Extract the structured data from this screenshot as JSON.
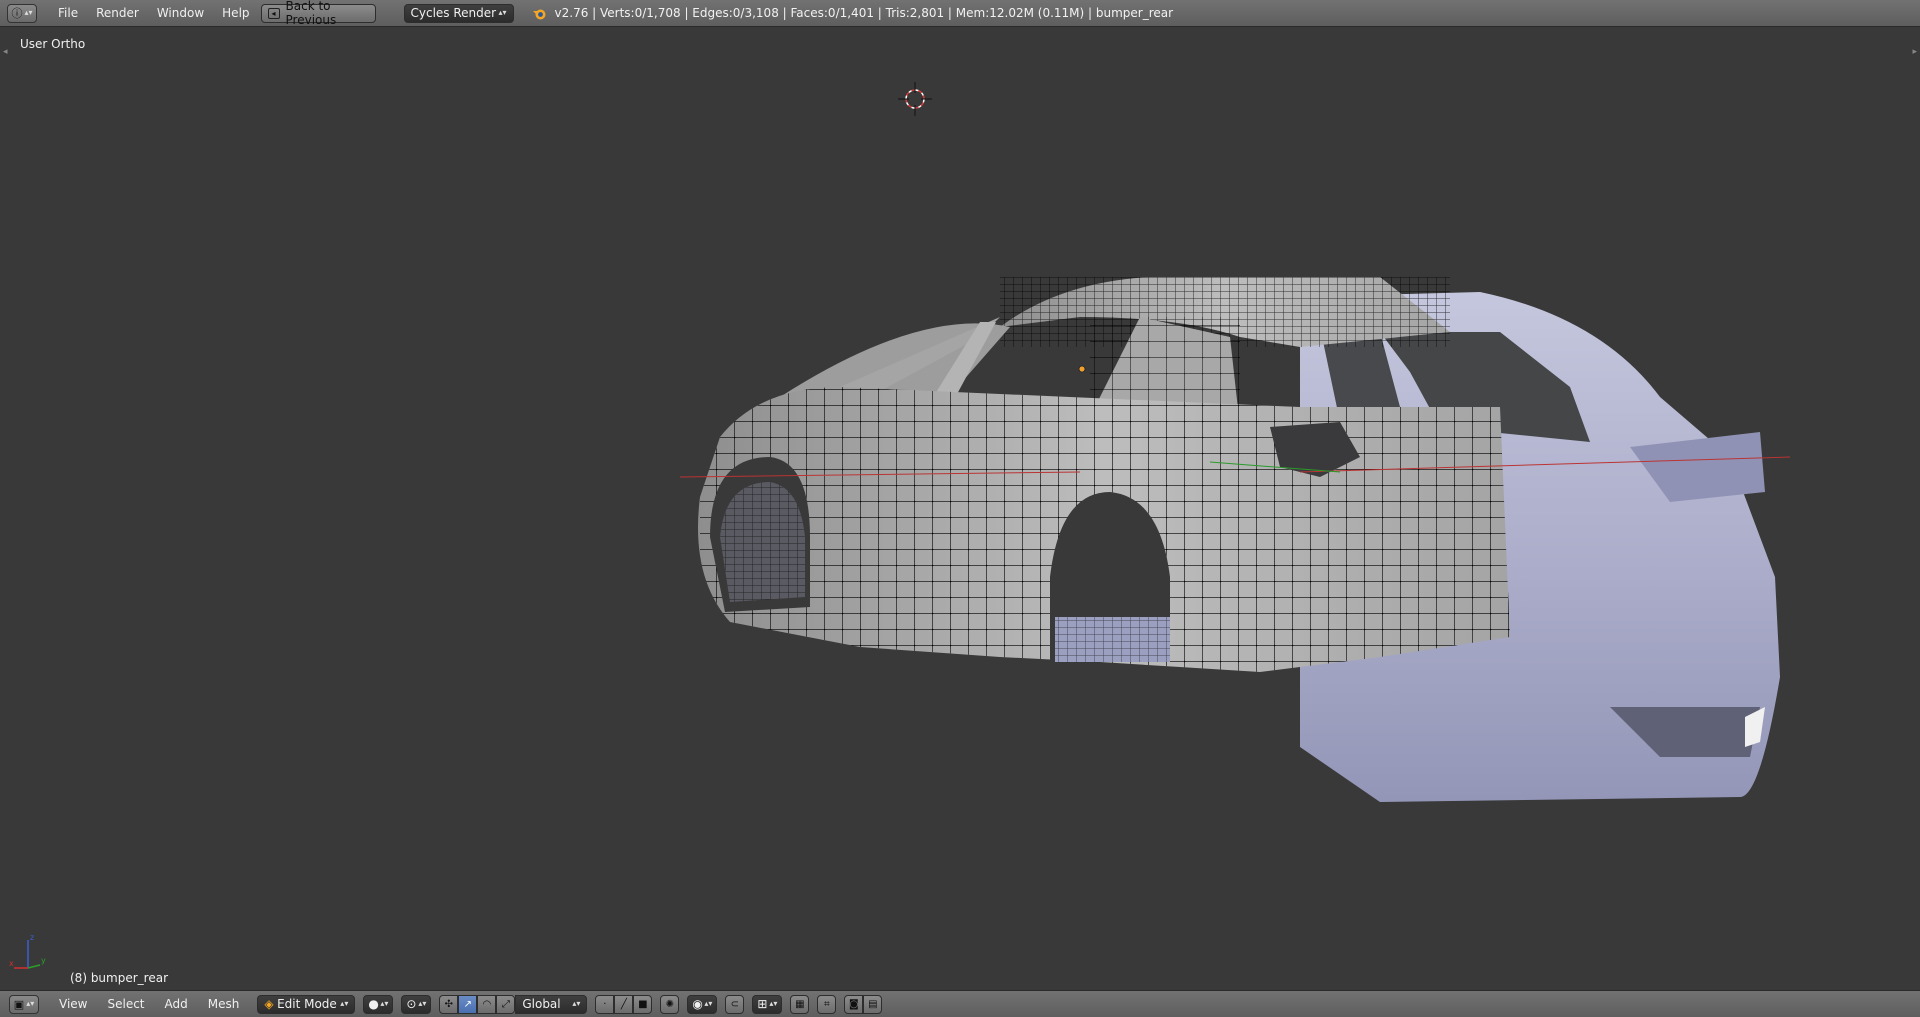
{
  "top_header": {
    "menus": [
      "File",
      "Render",
      "Window",
      "Help"
    ],
    "back_button": "Back to Previous",
    "render_engine": "Cycles Render",
    "stats": "v2.76 | Verts:0/1,708 | Edges:0/3,108 | Faces:0/1,401 | Tris:2,801 | Mem:12.02M (0.11M) | bumper_rear"
  },
  "viewport": {
    "view_name": "User Ortho",
    "object_label": "(8) bumper_rear",
    "axis_labels": {
      "x": "x",
      "y": "y",
      "z": "z"
    }
  },
  "bottom_header": {
    "menus": [
      "View",
      "Select",
      "Add",
      "Mesh"
    ],
    "mode": "Edit Mode",
    "orientation": "Global"
  },
  "colors": {
    "background": "#393939",
    "header": "#6a6a6a",
    "mesh_face": "#a9a9a9",
    "mesh_unselected_object": "#a6a8c4",
    "wire": "#000000",
    "active_button": "#5680c2"
  },
  "icons": {
    "editor_type": "info-editor-icon",
    "back": "back-screen-icon",
    "logo": "blender-logo-icon",
    "viewport_editor": "3d-view-editor-icon",
    "shading": "solid-sphere-icon",
    "pivot": "pivot-point-icon",
    "manipulators": [
      "translate-manipulator-icon",
      "rotate-manipulator-icon",
      "scale-manipulator-icon"
    ],
    "select_modes": [
      "vertex-select-icon",
      "edge-select-icon",
      "face-select-icon"
    ],
    "misc": [
      "occlude-geometry-icon",
      "proportional-edit-icon",
      "snap-icon",
      "snap-target-icon",
      "render-icon",
      "render-anim-icon"
    ]
  }
}
